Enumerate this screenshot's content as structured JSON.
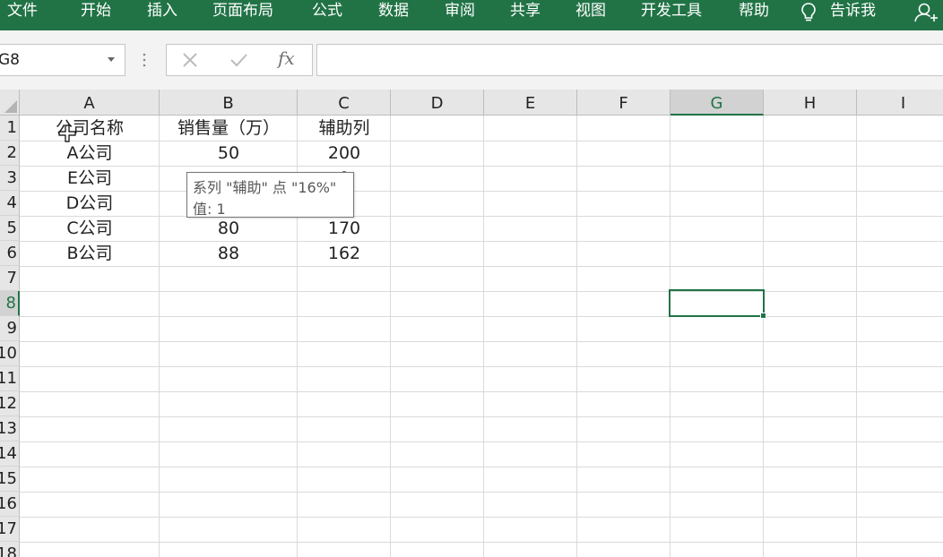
{
  "ribbon": {
    "tabs": [
      "文件",
      "开始",
      "插入",
      "页面布局",
      "公式",
      "数据",
      "审阅",
      "共享",
      "视图",
      "开发工具",
      "帮助"
    ],
    "tell_me": "告诉我",
    "bg_color": "#217346"
  },
  "formula_bar": {
    "name_box": "G8",
    "fx": "fx",
    "formula": ""
  },
  "grid": {
    "columns": [
      "A",
      "B",
      "C",
      "D",
      "E",
      "F",
      "G",
      "H",
      "I"
    ],
    "selected_column": "G",
    "rows": [
      "1",
      "2",
      "3",
      "4",
      "5",
      "6",
      "7",
      "8",
      "9",
      "10",
      "11",
      "12",
      "13",
      "14",
      "15",
      "16",
      "17",
      "18"
    ],
    "selected_row": "8",
    "cells": {
      "A1": "公司名称",
      "B1": "销售量（万）",
      "C1": "辅助列",
      "A2": "A公司",
      "B2": "50",
      "C2": "200",
      "A3": "E公司",
      "C3": "0",
      "A4": "D公司",
      "C4": "6",
      "A5": "C公司",
      "B5": "80",
      "C5": "170",
      "A6": "B公司",
      "B6": "88",
      "C6": "162"
    },
    "active_cell": "G8"
  },
  "tooltip": {
    "line1": "系列 \"辅助\" 点 \"16%\"",
    "line2": "值: 1"
  }
}
